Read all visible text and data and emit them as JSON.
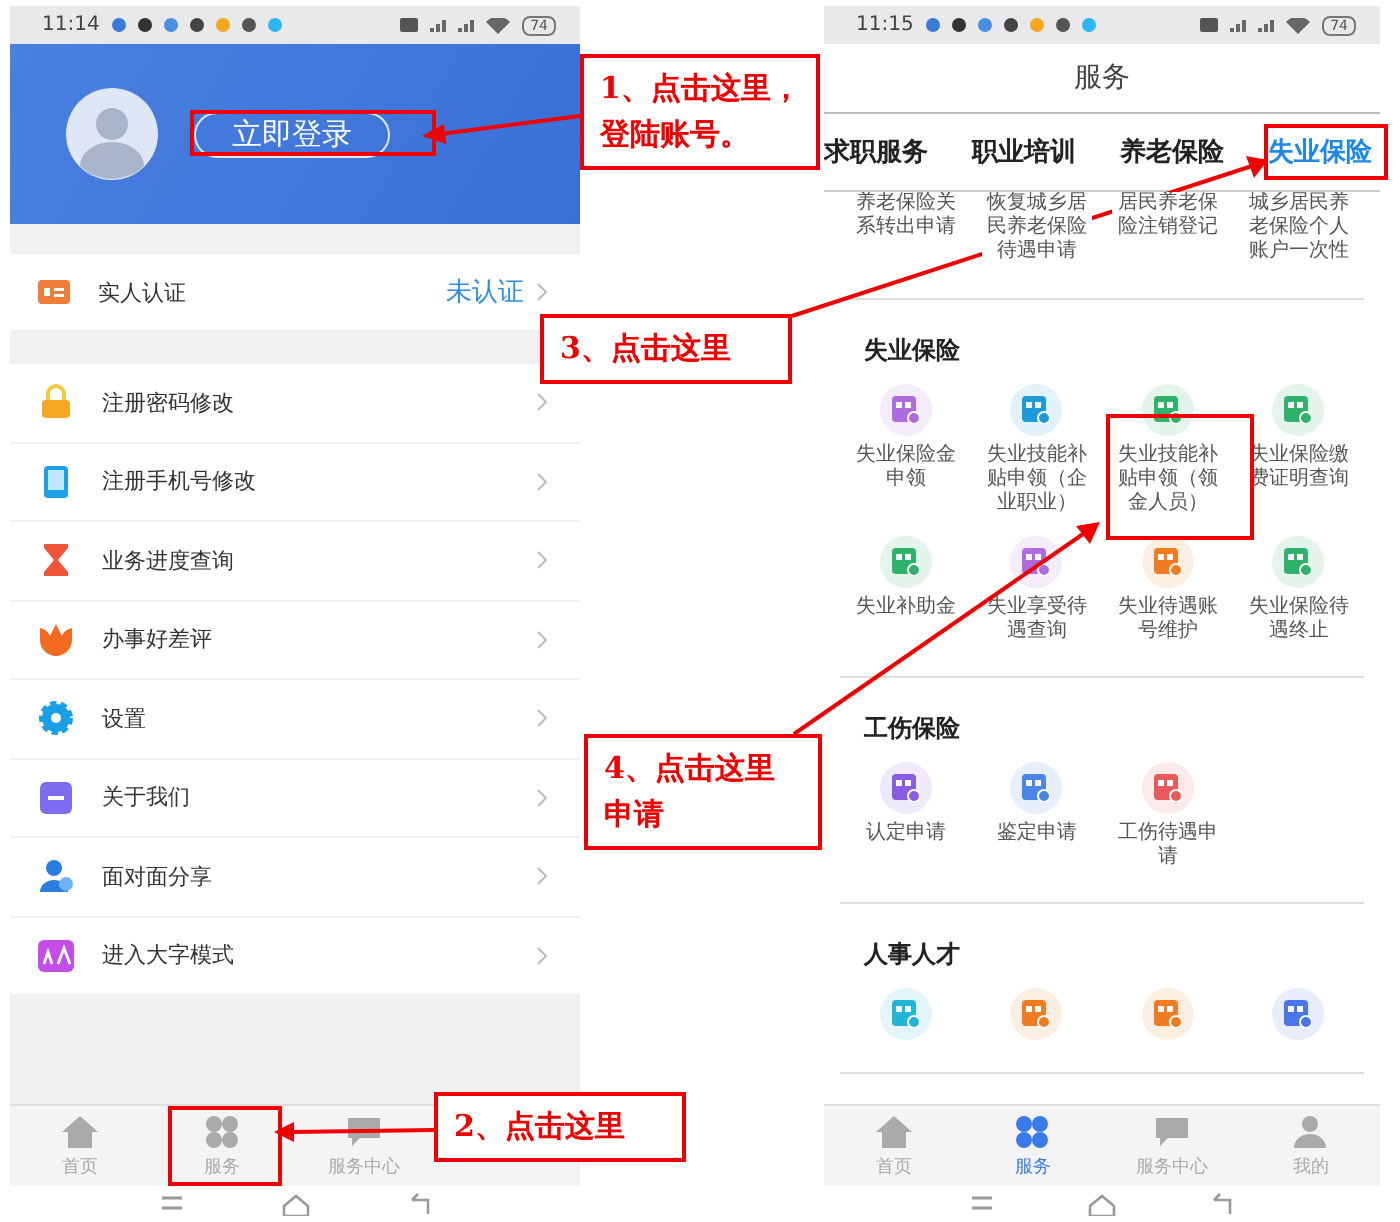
{
  "left_phone": {
    "status_bar": {
      "time": "11:14",
      "battery": "74"
    },
    "profile": {
      "login_button": "立即登录"
    },
    "verification": {
      "label": "实人认证",
      "status": "未认证",
      "color": "#f07c3a"
    },
    "menu": [
      {
        "label": "注册密码修改",
        "kind": "lock",
        "color": "#f5a623"
      },
      {
        "label": "注册手机号修改",
        "kind": "tablet",
        "color": "#1ea0e6"
      },
      {
        "label": "业务进度查询",
        "kind": "hourglass",
        "color": "#f0553a"
      },
      {
        "label": "办事好差评",
        "kind": "flower",
        "color": "#f26b21"
      },
      {
        "label": "设置",
        "kind": "gear",
        "color": "#1a9ee6"
      },
      {
        "label": "关于我们",
        "kind": "minus",
        "color": "#7b6cf0"
      },
      {
        "label": "面对面分享",
        "kind": "person",
        "color": "#2a7de1"
      },
      {
        "label": "进入大字模式",
        "kind": "text-size",
        "color": "#c44de8"
      }
    ],
    "tab_bar": [
      {
        "label": "首页",
        "kind": "home",
        "selected": false
      },
      {
        "label": "服务",
        "kind": "grid",
        "selected": false
      },
      {
        "label": "服务中心",
        "kind": "chat",
        "selected": false
      }
    ]
  },
  "right_phone": {
    "status_bar": {
      "time": "11:15",
      "battery": "74"
    },
    "title": "服务",
    "tabs": [
      {
        "label": "求职服务",
        "selected": false
      },
      {
        "label": "职业培训",
        "selected": false
      },
      {
        "label": "养老保险",
        "selected": false
      },
      {
        "label": "失业保险",
        "selected": true
      }
    ],
    "partial_items": [
      "养老保险关系转出申请",
      "恢复城乡居民养老保险待遇申请",
      "居民养老保险注销登记",
      "城乡居民养老保险个人账户一次性"
    ],
    "sections": [
      {
        "title": "失业保险",
        "items": [
          {
            "label": "失业保险金申领",
            "color": "#b06be0"
          },
          {
            "label": "失业技能补贴申领（企业职业）",
            "color": "#1e9bd6"
          },
          {
            "label": "失业技能补贴申领（领金人员）",
            "color": "#2fb36a"
          },
          {
            "label": "失业保险缴费证明查询",
            "color": "#2fb36a"
          },
          {
            "label": "失业补助金",
            "color": "#2fb36a"
          },
          {
            "label": "失业享受待遇查询",
            "color": "#b06be0"
          },
          {
            "label": "失业待遇账号维护",
            "color": "#f07c22"
          },
          {
            "label": "失业保险待遇终止",
            "color": "#2fb36a"
          }
        ]
      },
      {
        "title": "工伤保险",
        "items": [
          {
            "label": "认定申请",
            "color": "#8a5ce6"
          },
          {
            "label": "鉴定申请",
            "color": "#4a86e8"
          },
          {
            "label": "工伤待遇申请",
            "color": "#e85a5a"
          }
        ]
      },
      {
        "title": "人事人才",
        "items": [
          {
            "color": "#22b5d6"
          },
          {
            "color": "#f07c22"
          },
          {
            "color": "#f07c22"
          },
          {
            "color": "#4a76e8"
          }
        ]
      }
    ],
    "tab_bar": [
      {
        "label": "首页",
        "kind": "home",
        "selected": false
      },
      {
        "label": "服务",
        "kind": "grid",
        "selected": true
      },
      {
        "label": "服务中心",
        "kind": "chat",
        "selected": false
      },
      {
        "label": "我的",
        "kind": "person",
        "selected": false
      }
    ]
  },
  "callouts": [
    {
      "lines": [
        "1、点击这里，",
        "登陆账号。"
      ]
    },
    {
      "lines": [
        "2、点击这里"
      ]
    },
    {
      "lines": [
        "3、点击这里"
      ]
    },
    {
      "lines": [
        "4、点击这里",
        "申请"
      ]
    }
  ]
}
